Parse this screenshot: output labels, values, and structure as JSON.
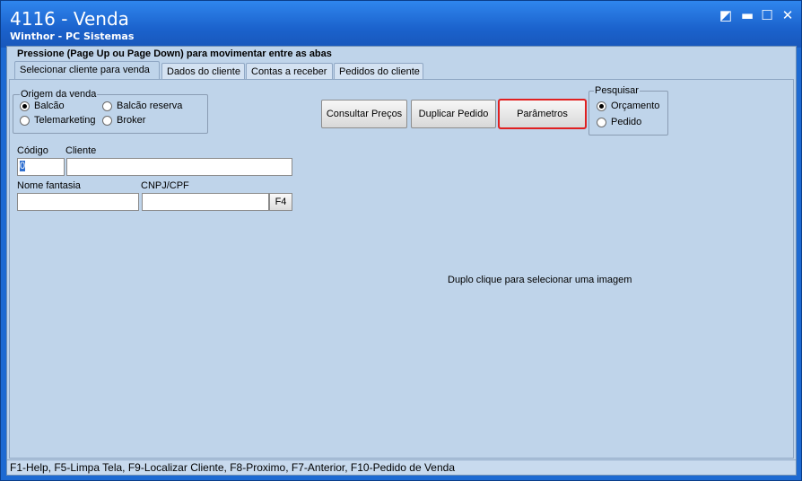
{
  "window": {
    "title": "4116 - Venda",
    "subtitle": "Winthor - PC Sistemas",
    "controls": {
      "restore": "◩",
      "minimize": "▬",
      "maximize": "☐",
      "close": "✕"
    }
  },
  "header": {
    "text": "Pressione (Page Up ou Page Down) para movimentar entre as abas"
  },
  "tabs": [
    {
      "label": "Selecionar cliente para venda",
      "active": true
    },
    {
      "label": "Dados do cliente",
      "active": false
    },
    {
      "label": "Contas a receber",
      "active": false
    },
    {
      "label": "Pedidos do cliente",
      "active": false
    }
  ],
  "origem": {
    "legend": "Origem da venda",
    "options": [
      {
        "label": "Balcão",
        "selected": true
      },
      {
        "label": "Balcão reserva",
        "selected": false
      },
      {
        "label": "Telemarketing",
        "selected": false
      },
      {
        "label": "Broker",
        "selected": false
      }
    ]
  },
  "buttons": {
    "consultar": "Consultar Preços",
    "duplicar": "Duplicar Pedido",
    "parametros": "Parâmetros"
  },
  "pesquisar": {
    "legend": "Pesquisar",
    "options": [
      {
        "label": "Orçamento",
        "selected": true
      },
      {
        "label": "Pedido",
        "selected": false
      }
    ]
  },
  "form": {
    "codigo_label": "Código",
    "codigo_value": "0",
    "cliente_label": "Cliente",
    "cliente_value": "",
    "fantasia_label": "Nome fantasia",
    "fantasia_value": "",
    "cnpj_label": "CNPJ/CPF",
    "cnpj_value": "",
    "f4_label": "F4"
  },
  "image_hint": "Duplo clique para selecionar uma imagem",
  "statusbar": "F1-Help, F5-Limpa Tela, F9-Localizar Cliente, F8-Proximo, F7-Anterior, F10-Pedido de Venda"
}
